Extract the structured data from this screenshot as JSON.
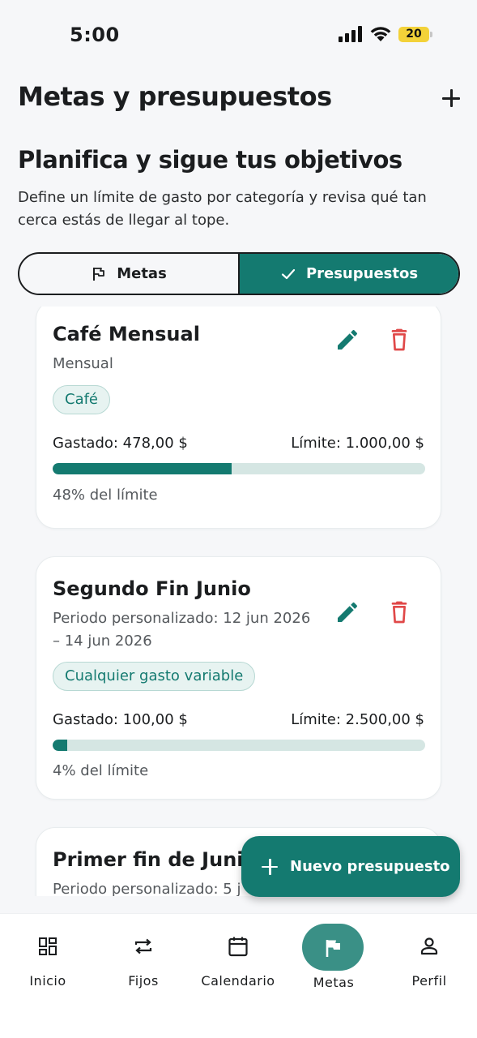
{
  "status_bar": {
    "time": "5:00",
    "battery": "20"
  },
  "header": {
    "title": "Metas y presupuestos"
  },
  "intro": {
    "title": "Planifica y sigue tus objetivos",
    "description": "Define un límite de gasto por categoría y revisa qué tan cerca estás de llegar al tope."
  },
  "segmented": {
    "metas_label": "Metas",
    "presupuestos_label": "Presupuestos",
    "selected": "Presupuestos"
  },
  "budgets": [
    {
      "title": "Café Mensual",
      "period": "Mensual",
      "category": "Café",
      "spent": "Gastado: 478,00 $",
      "limit": "Límite: 1.000,00 $",
      "progress_percent": 48,
      "percent_label": "48% del límite"
    },
    {
      "title": "Segundo Fin Junio",
      "period_line1": "Periodo personalizado: 12 jun 2026",
      "period_line2": "– 14 jun 2026",
      "category": "Cualquier gasto variable",
      "spent": "Gastado: 100,00 $",
      "limit": "Límite: 2.500,00 $",
      "progress_percent": 4,
      "percent_label": "4% del límite"
    },
    {
      "title": "Primer fin de Junio",
      "period": "Periodo personalizado: 5 j"
    }
  ],
  "fab": {
    "label": "Nuevo presupuesto"
  },
  "nav": {
    "items": [
      {
        "label": "Inicio",
        "icon": "dashboard-icon"
      },
      {
        "label": "Fijos",
        "icon": "repeat-icon"
      },
      {
        "label": "Calendario",
        "icon": "calendar-icon"
      },
      {
        "label": "Metas",
        "icon": "flag-icon",
        "active": true
      },
      {
        "label": "Perfil",
        "icon": "person-icon"
      }
    ]
  },
  "colors": {
    "accent": "#147a70",
    "danger": "#e04848",
    "track": "#d5e6e3"
  }
}
